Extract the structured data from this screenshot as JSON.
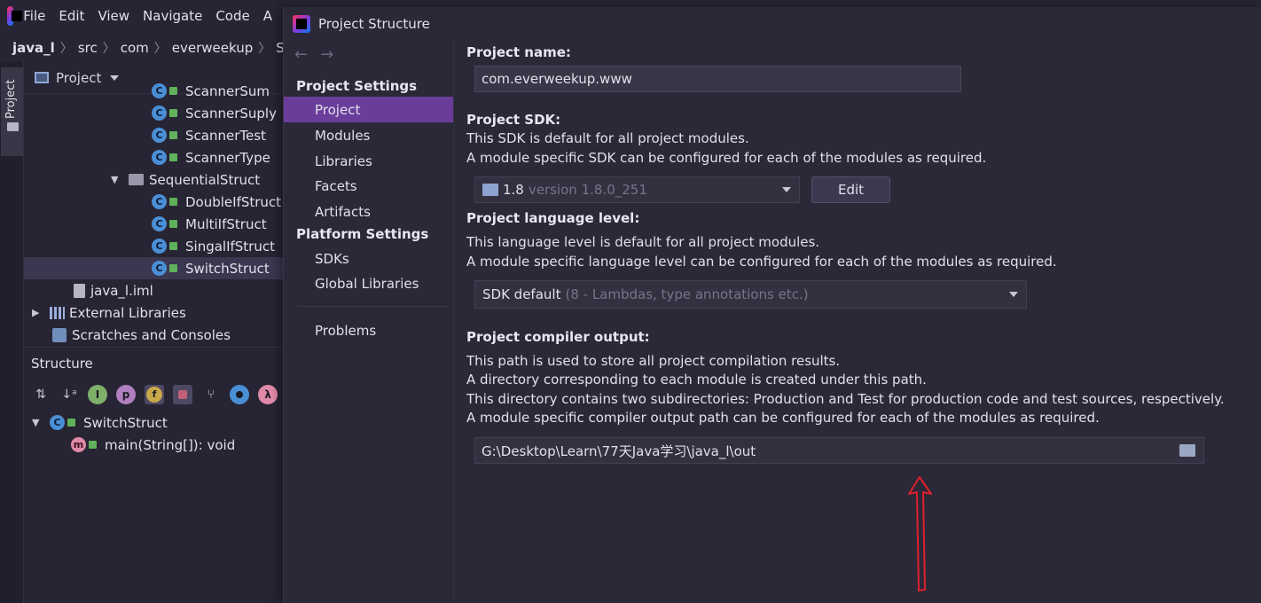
{
  "menubar": {
    "items": [
      "File",
      "Edit",
      "View",
      "Navigate",
      "Code",
      "A"
    ]
  },
  "navbar": {
    "crumbs": [
      "java_l",
      "src",
      "com",
      "everweekup",
      "Sequ"
    ]
  },
  "tool_window": {
    "stripe_label": "Project",
    "header": "Project",
    "tree": [
      {
        "label": "ScannerSum"
      },
      {
        "label": "ScannerSuply"
      },
      {
        "label": "ScannerTest"
      },
      {
        "label": "ScannerType"
      },
      {
        "label": "SequentialStruct"
      },
      {
        "label": "DoubleIfStruct"
      },
      {
        "label": "MultiIfStruct"
      },
      {
        "label": "SingalIfStruct"
      },
      {
        "label": "SwitchStruct"
      },
      {
        "label": "java_l.iml"
      },
      {
        "label": "External Libraries"
      },
      {
        "label": "Scratches and Consoles"
      }
    ]
  },
  "structure": {
    "title": "Structure",
    "toolbar": [
      "sort-visibility",
      "sort-alpha",
      "inherited",
      "p",
      "f",
      "lock",
      "tree",
      "circle",
      "lambda"
    ],
    "class_name": "SwitchStruct",
    "member": "main(String[]): void"
  },
  "dialog": {
    "title": "Project Structure",
    "sidebar": {
      "project_settings_header": "Project Settings",
      "project_settings": [
        "Project",
        "Modules",
        "Libraries",
        "Facets",
        "Artifacts"
      ],
      "platform_settings_header": "Platform Settings",
      "platform_settings": [
        "SDKs",
        "Global Libraries"
      ],
      "problems": "Problems",
      "selected": "Project"
    },
    "project_name": {
      "label": "Project name:",
      "value": "com.everweekup.www"
    },
    "sdk": {
      "label": "Project SDK:",
      "desc1": "This SDK is default for all project modules.",
      "desc2": "A module specific SDK can be configured for each of the modules as required.",
      "selected": "1.8",
      "version": "version 1.8.0_251",
      "edit_button": "Edit"
    },
    "language_level": {
      "label": "Project language level:",
      "desc1": "This language level is default for all project modules.",
      "desc2": "A module specific language level can be configured for each of the modules as required.",
      "selected": "SDK default",
      "detail": "(8 - Lambdas, type annotations etc.)"
    },
    "compiler_output": {
      "label": "Project compiler output:",
      "desc1": "This path is used to store all project compilation results.",
      "desc2": "A directory corresponding to each module is created under this path.",
      "desc3": "This directory contains two subdirectories: Production and Test for production code and test sources, respectively.",
      "desc4": "A module specific compiler output path can be configured for each of the modules as required.",
      "path": "G:\\Desktop\\Learn\\77天Java学习\\java_l\\out"
    }
  },
  "colors": {
    "accent_selection": "#6a3d9a",
    "annotation_arrow": "#e0202a"
  }
}
